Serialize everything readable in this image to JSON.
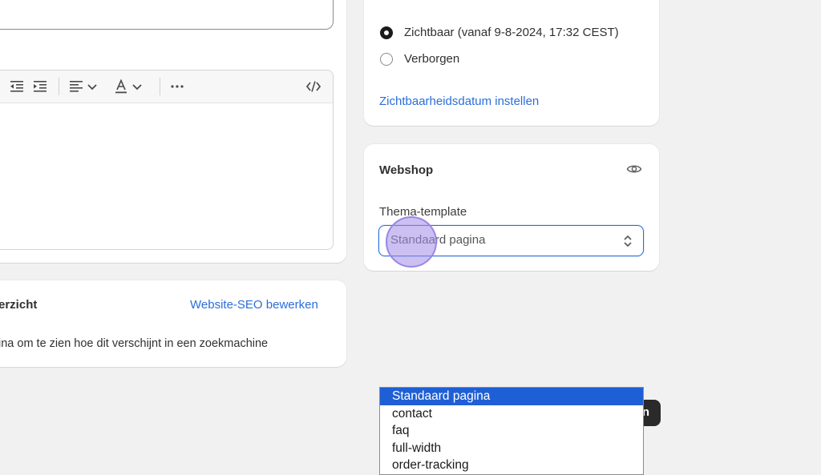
{
  "editor": {
    "toolbar_icons": [
      "list-icon",
      "outdent-icon",
      "indent-icon",
      "align-icon",
      "chevron-down-icon",
      "text-color-icon",
      "chevron-down-icon",
      "more-icon",
      "code-icon"
    ]
  },
  "seo": {
    "title": "erzicht",
    "edit_link": "Website-SEO bewerken",
    "description": "ina om te zien hoe dit verschijnt in een zoekmachine"
  },
  "visibility": {
    "options": [
      {
        "label": "Zichtbaar (vanaf 9-8-2024, 17:32 CEST)",
        "selected": true
      },
      {
        "label": "Verborgen",
        "selected": false
      }
    ],
    "set_date_link": "Zichtbaarheidsdatum instellen"
  },
  "webshop": {
    "title": "Webshop",
    "template_label": "Thema-template",
    "template_value": "Standaard pagina"
  },
  "dropdown": {
    "options": [
      "Standaard pagina",
      "contact",
      "faq",
      "full-width",
      "order-tracking"
    ],
    "selected_index": 0
  },
  "dark_button": {
    "label": "n"
  },
  "colors": {
    "accent": "#2b6ed8",
    "selected_option": "#1f5fd6",
    "background": "#f1f1f1"
  }
}
